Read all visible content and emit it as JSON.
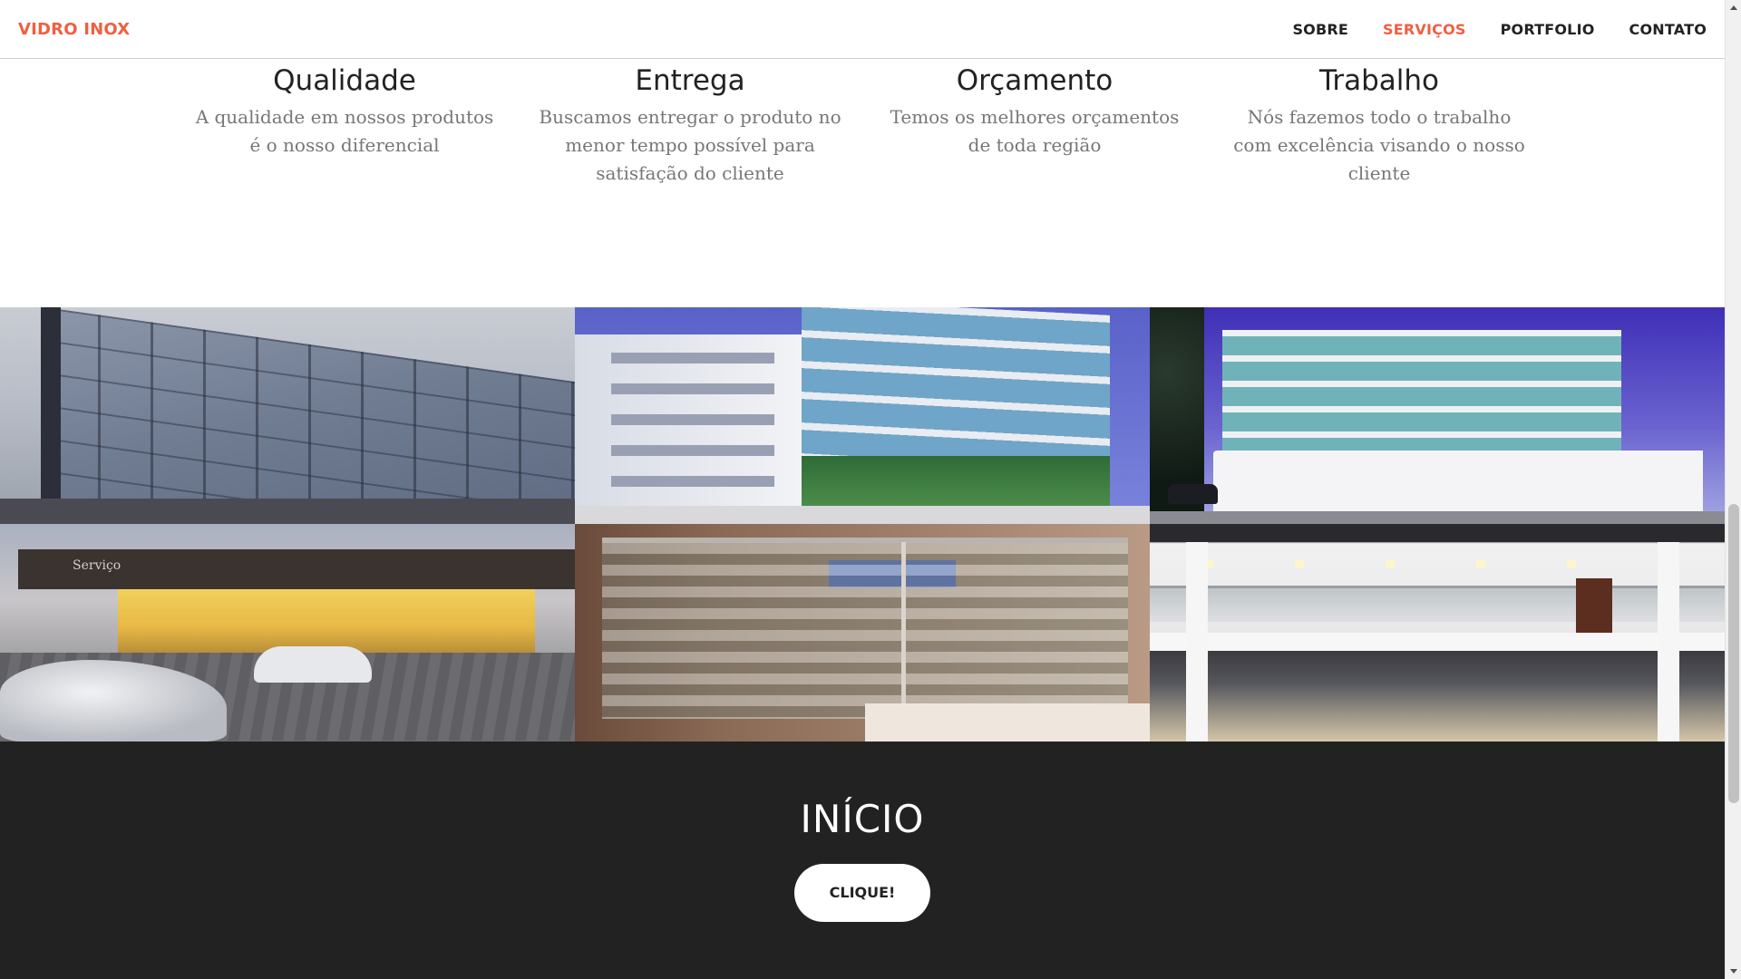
{
  "navbar": {
    "brand": "VIDRO INOX",
    "links": [
      {
        "label": "SOBRE",
        "active": false
      },
      {
        "label": "SERVIÇOS",
        "active": true
      },
      {
        "label": "PORTFOLIO",
        "active": false
      },
      {
        "label": "CONTATO",
        "active": false
      }
    ]
  },
  "services": [
    {
      "title": "Qualidade",
      "description_lines": [
        "A qualidade em nossos produtos",
        "é o nosso diferencial"
      ]
    },
    {
      "title": "Entrega",
      "description_lines": [
        "Buscamos entregar o produto no",
        "menor tempo possível para",
        "satisfação do cliente"
      ]
    },
    {
      "title": "Orçamento",
      "description_lines": [
        "Temos os melhores orçamentos",
        "de toda região"
      ]
    },
    {
      "title": "Trabalho",
      "description_lines": [
        "Nós fazemos todo o trabalho",
        "com excelência visando o nosso",
        "cliente"
      ]
    }
  ],
  "portfolio": {
    "tiles": [
      {
        "subject": "glass facade building"
      },
      {
        "subject": "white residential building with glass balconies"
      },
      {
        "subject": "building with glass railings under purple sky"
      },
      {
        "subject": "Hyundai dealership",
        "sign_text": "Serviço"
      },
      {
        "subject": "glass shower enclosure"
      },
      {
        "subject": "interior with glass balcony railing"
      }
    ]
  },
  "cta": {
    "title": "INÍCIO",
    "button_label": "CLIQUE!"
  },
  "colors": {
    "accent": "#f05f40",
    "dark": "#222222",
    "muted_text": "#777777"
  }
}
